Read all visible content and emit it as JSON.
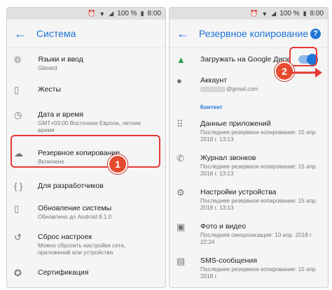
{
  "status": {
    "percent": "100 %",
    "time": "8:00"
  },
  "left": {
    "title": "Система",
    "items": [
      {
        "icon": "globe-icon",
        "title": "Языки и ввод",
        "subtitle": "Gboard"
      },
      {
        "icon": "gesture-phone-icon",
        "title": "Жесты",
        "subtitle": ""
      },
      {
        "icon": "clock-icon",
        "title": "Дата и время",
        "subtitle": "GMT+03:00 Восточная Европа, летнее время"
      },
      {
        "icon": "cloud-upload-icon",
        "title": "Резервное копирование",
        "subtitle": "Включено"
      },
      {
        "icon": "code-braces-icon",
        "title": "Для разработчиков",
        "subtitle": ""
      },
      {
        "icon": "system-update-icon",
        "title": "Обновление системы",
        "subtitle": "Обновлено до Android 8.1.0"
      },
      {
        "icon": "reset-icon",
        "title": "Сброс настроек",
        "subtitle": "Можно сбросить настройки сети, приложений или устройства"
      },
      {
        "icon": "certificate-icon",
        "title": "Сертификация",
        "subtitle": ""
      }
    ],
    "badge": "1"
  },
  "right": {
    "title": "Резервное копирование",
    "help": "?",
    "upload_label": "Загружать на Google Диск",
    "upload_on": true,
    "account_label": "Аккаунт",
    "account_value": "@gmail.com",
    "section": "Контент",
    "items": [
      {
        "icon": "apps-grid-icon",
        "title": "Данные приложений",
        "subtitle": "Последнее резервное копирование: 15 апр. 2018 г. 13:13"
      },
      {
        "icon": "phone-icon",
        "title": "Журнал звонков",
        "subtitle": "Последнее резервное копирование: 15 апр. 2018 г. 13:13"
      },
      {
        "icon": "settings-gear-icon",
        "title": "Настройки устройства",
        "subtitle": "Последнее резервное копирование: 15 апр. 2018 г. 13:13"
      },
      {
        "icon": "photo-icon",
        "title": "Фото и видео",
        "subtitle": "Последняя синхронизация: 10 апр. 2018 г. 22:24"
      },
      {
        "icon": "sms-icon",
        "title": "SMS-сообщения",
        "subtitle": "Последнее резервное копирование: 15 апр. 2018 г."
      }
    ],
    "badge": "2"
  },
  "colors": {
    "accent": "#1e74d6",
    "highlight": "#e53935",
    "badge": "#e64a2e"
  }
}
